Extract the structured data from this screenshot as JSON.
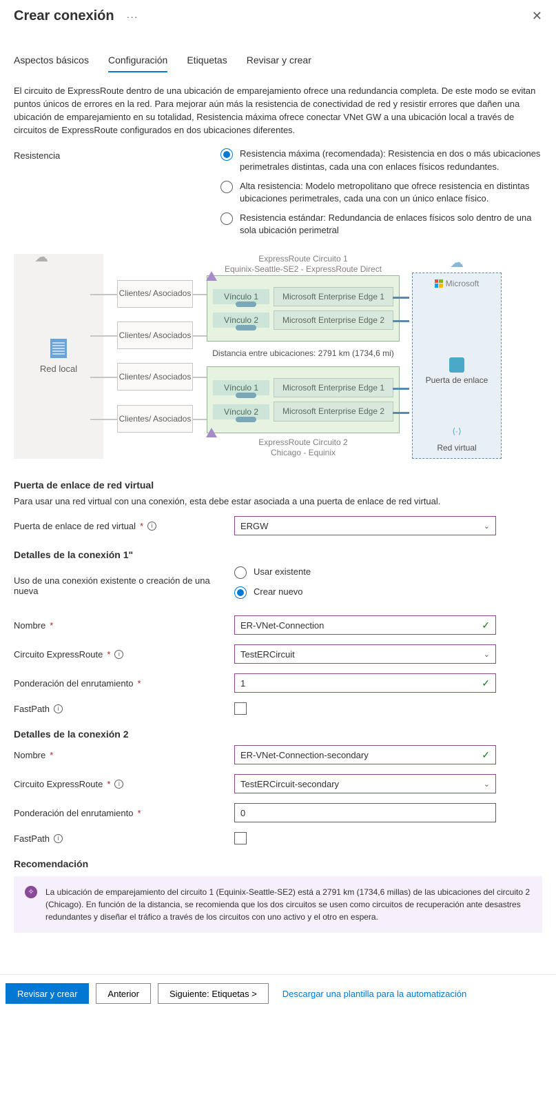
{
  "header": {
    "title": "Crear conexión"
  },
  "tabs": [
    "Aspectos básicos",
    "Configuración",
    "Etiquetas",
    "Revisar y crear"
  ],
  "active_tab": 1,
  "intro": "El circuito de ExpressRoute dentro de una ubicación de emparejamiento ofrece una redundancia completa. De este modo se evitan puntos únicos de errores en la red. Para mejorar aún más la resistencia de conectividad de red y resistir errores que dañen una ubicación de emparejamiento en su totalidad, Resistencia máxima ofrece conectar VNet GW a una ubicación local a través de circuitos de ExpressRoute configurados en dos ubicaciones diferentes.",
  "resiliency": {
    "label": "Resistencia",
    "options": [
      "Resistencia máxima (recomendada): Resistencia en dos o más ubicaciones perimetrales distintas, cada una con enlaces físicos redundantes.",
      "Alta resistencia: Modelo metropolitano que ofrece resistencia en distintas ubicaciones perimetrales, cada una con un único enlace físico.",
      "Resistencia estándar: Redundancia de enlaces físicos solo dentro de una sola ubicación perimetral"
    ],
    "selected": 0
  },
  "diagram": {
    "onprem": "Red local",
    "partner": "Clientes/\nAsociados",
    "circuit1_title": "ExpressRoute Circuito 1",
    "circuit1_sub": "Equinix-Seattle-SE2 - ExpressRoute Direct",
    "link1": "Vínculo 1",
    "link2": "Vínculo 2",
    "msee1": "Microsoft\nEnterprise Edge 1",
    "msee2": "Microsoft\nEnterprise Edge 2",
    "distance": "Distancia entre ubicaciones: 2791 km (1734,6 mi)",
    "circuit2_title": "ExpressRoute Circuito 2",
    "circuit2_sub": "Chicago - Equinix",
    "ms": "Microsoft",
    "gateway": "Puerta\nde enlace",
    "vnet": "Red virtual"
  },
  "gateway_section": {
    "heading": "Puerta de enlace de red virtual",
    "desc": "Para usar una red virtual con una conexión, esta debe estar asociada a una puerta de enlace de red virtual.",
    "label": "Puerta de enlace de red virtual",
    "value": "ERGW"
  },
  "conn1": {
    "heading": "Detalles de la conexión 1\"",
    "use_label": "Uso de una conexión existente o creación de una nueva",
    "opt_existing": "Usar existente",
    "opt_new": "Crear nuevo",
    "name_label": "Nombre",
    "name_value": "ER-VNet-Connection",
    "circuit_label": "Circuito ExpressRoute",
    "circuit_value": "TestERCircuit",
    "weight_label": "Ponderación del enrutamiento",
    "weight_value": "1",
    "fastpath_label": "FastPath"
  },
  "conn2": {
    "heading": "Detalles de la conexión 2",
    "name_label": "Nombre",
    "name_value": "ER-VNet-Connection-secondary",
    "circuit_label": "Circuito ExpressRoute",
    "circuit_value": "TestERCircuit-secondary",
    "weight_label": "Ponderación del enrutamiento",
    "weight_value": "0",
    "fastpath_label": "FastPath"
  },
  "reco": {
    "heading": "Recomendación",
    "text": "La ubicación de emparejamiento del circuito 1 (Equinix-Seattle-SE2) está a 2791 km (1734,6 millas) de las ubicaciones del circuito 2 (Chicago). En función de la distancia, se recomienda que los dos circuitos se usen como circuitos de recuperación ante desastres redundantes y diseñar el tráfico a través de los circuitos con uno activo y el otro en espera."
  },
  "footer": {
    "review": "Revisar y crear",
    "prev": "Anterior",
    "next": "Siguiente: Etiquetas >",
    "download": "Descargar una plantilla para la automatización"
  }
}
